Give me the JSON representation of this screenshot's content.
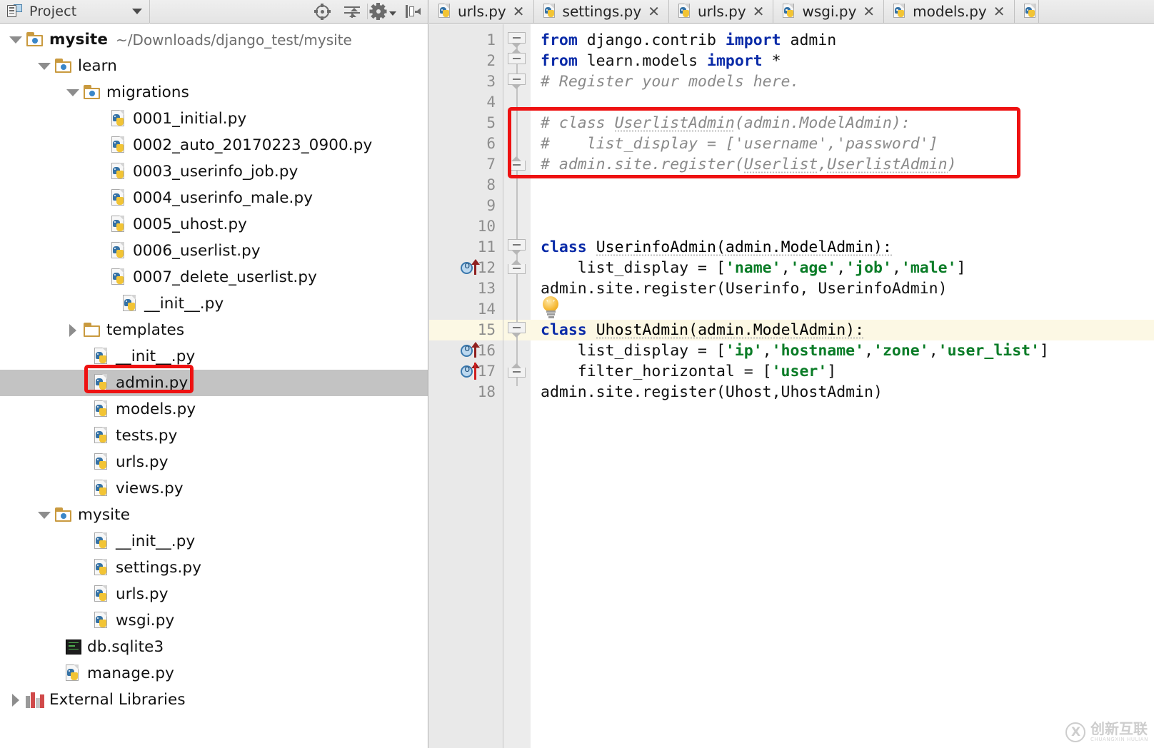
{
  "theme": {
    "accent_red": "#ee1111",
    "selection_gray": "#c3c3c3",
    "current_line_yellow": "#fcf8e4",
    "keyword_blue": "#0a2ba8",
    "string_green": "#0a7c27",
    "comment_gray": "#8a8a8a",
    "gutter_bg": "#e9e9e9",
    "toolbar_bg": "#e7e7e7"
  },
  "project_panel": {
    "title": "Project",
    "title_icon": "project-view-icon",
    "dropdown_icon": "chevron-down-icon",
    "toolbar_buttons": [
      {
        "name": "locate-in-tree-button",
        "icon": "crosshair-target-icon"
      },
      {
        "name": "collapse-all-button",
        "icon": "collapse-all-icon"
      },
      {
        "name": "settings-button",
        "icon": "gear-icon"
      },
      {
        "name": "hide-panel-button",
        "icon": "hide-sidebar-icon"
      }
    ]
  },
  "tree": [
    {
      "label": "mysite",
      "secondary": "~/Downloads/django_test/mysite",
      "icon": "folder-module-icon",
      "indent": 0,
      "twisty": "expanded",
      "bold": true,
      "selected": false
    },
    {
      "label": "learn",
      "secondary": "",
      "icon": "folder-module-icon",
      "indent": 1,
      "twisty": "expanded",
      "bold": false,
      "selected": false
    },
    {
      "label": "migrations",
      "secondary": "",
      "icon": "folder-module-icon",
      "indent": 2,
      "twisty": "expanded",
      "bold": false,
      "selected": false
    },
    {
      "label": "0001_initial.py",
      "secondary": "",
      "icon": "python-file-icon",
      "indent": 3,
      "twisty": "none",
      "bold": false,
      "selected": false
    },
    {
      "label": "0002_auto_20170223_0900.py",
      "secondary": "",
      "icon": "python-file-icon",
      "indent": 3,
      "twisty": "none",
      "bold": false,
      "selected": false
    },
    {
      "label": "0003_userinfo_job.py",
      "secondary": "",
      "icon": "python-file-icon",
      "indent": 3,
      "twisty": "none",
      "bold": false,
      "selected": false
    },
    {
      "label": "0004_userinfo_male.py",
      "secondary": "",
      "icon": "python-file-icon",
      "indent": 3,
      "twisty": "none",
      "bold": false,
      "selected": false
    },
    {
      "label": "0005_uhost.py",
      "secondary": "",
      "icon": "python-file-icon",
      "indent": 3,
      "twisty": "none",
      "bold": false,
      "selected": false
    },
    {
      "label": "0006_userlist.py",
      "secondary": "",
      "icon": "python-file-icon",
      "indent": 3,
      "twisty": "none",
      "bold": false,
      "selected": false
    },
    {
      "label": "0007_delete_userlist.py",
      "secondary": "",
      "icon": "python-file-icon",
      "indent": 3,
      "twisty": "none",
      "bold": false,
      "selected": false
    },
    {
      "label": "__init__.py",
      "secondary": "",
      "icon": "python-file-icon",
      "indent": 3.4,
      "twisty": "none",
      "bold": false,
      "selected": false
    },
    {
      "label": "templates",
      "secondary": "",
      "icon": "folder-plain-icon",
      "indent": 2,
      "twisty": "collapsed",
      "bold": false,
      "selected": false
    },
    {
      "label": "__init__.py",
      "secondary": "",
      "icon": "python-file-icon",
      "indent": 2.4,
      "twisty": "none",
      "bold": false,
      "selected": false
    },
    {
      "label": "admin.py",
      "secondary": "",
      "icon": "python-file-icon",
      "indent": 2.4,
      "twisty": "none",
      "bold": false,
      "selected": true
    },
    {
      "label": "models.py",
      "secondary": "",
      "icon": "python-file-icon",
      "indent": 2.4,
      "twisty": "none",
      "bold": false,
      "selected": false
    },
    {
      "label": "tests.py",
      "secondary": "",
      "icon": "python-file-icon",
      "indent": 2.4,
      "twisty": "none",
      "bold": false,
      "selected": false
    },
    {
      "label": "urls.py",
      "secondary": "",
      "icon": "python-file-icon",
      "indent": 2.4,
      "twisty": "none",
      "bold": false,
      "selected": false
    },
    {
      "label": "views.py",
      "secondary": "",
      "icon": "python-file-icon",
      "indent": 2.4,
      "twisty": "none",
      "bold": false,
      "selected": false
    },
    {
      "label": "mysite",
      "secondary": "",
      "icon": "folder-module-icon",
      "indent": 1,
      "twisty": "expanded",
      "bold": false,
      "selected": false
    },
    {
      "label": "__init__.py",
      "secondary": "",
      "icon": "python-file-icon",
      "indent": 2.4,
      "twisty": "none",
      "bold": false,
      "selected": false
    },
    {
      "label": "settings.py",
      "secondary": "",
      "icon": "python-file-icon",
      "indent": 2.4,
      "twisty": "none",
      "bold": false,
      "selected": false
    },
    {
      "label": "urls.py",
      "secondary": "",
      "icon": "python-file-icon",
      "indent": 2.4,
      "twisty": "none",
      "bold": false,
      "selected": false
    },
    {
      "label": "wsgi.py",
      "secondary": "",
      "icon": "python-file-icon",
      "indent": 2.4,
      "twisty": "none",
      "bold": false,
      "selected": false
    },
    {
      "label": "db.sqlite3",
      "secondary": "",
      "icon": "database-file-icon",
      "indent": 1.4,
      "twisty": "none",
      "bold": false,
      "selected": false
    },
    {
      "label": "manage.py",
      "secondary": "",
      "icon": "python-file-icon",
      "indent": 1.4,
      "twisty": "none",
      "bold": false,
      "selected": false
    },
    {
      "label": "External Libraries",
      "secondary": "",
      "icon": "library-icon",
      "indent": 0,
      "twisty": "collapsed",
      "bold": false,
      "selected": false
    }
  ],
  "editor": {
    "tabs": [
      {
        "label": "urls.py",
        "icon": "python-file-icon",
        "close_glyph": "✕",
        "active": false
      },
      {
        "label": "settings.py",
        "icon": "python-file-icon",
        "close_glyph": "✕",
        "active": false
      },
      {
        "label": "urls.py",
        "icon": "python-file-icon",
        "close_glyph": "✕",
        "active": false
      },
      {
        "label": "wsgi.py",
        "icon": "python-file-icon",
        "close_glyph": "✕",
        "active": false
      },
      {
        "label": "models.py",
        "icon": "python-file-icon",
        "close_glyph": "✕",
        "active": false
      }
    ],
    "partial_tab": {
      "label": "",
      "icon": "python-file-icon"
    },
    "current_line": 15,
    "line_numbers": [
      "1",
      "2",
      "3",
      "4",
      "5",
      "6",
      "7",
      "8",
      "9",
      "10",
      "11",
      "12",
      "13",
      "14",
      "15",
      "16",
      "17",
      "18"
    ],
    "lines": [
      {
        "n": 1,
        "tokens": [
          {
            "t": "from",
            "c": "kw"
          },
          {
            "t": " django.contrib ",
            "c": "plain"
          },
          {
            "t": "import",
            "c": "kw"
          },
          {
            "t": " admin",
            "c": "plain"
          }
        ]
      },
      {
        "n": 2,
        "tokens": [
          {
            "t": "from",
            "c": "kw"
          },
          {
            "t": " learn.models ",
            "c": "plain"
          },
          {
            "t": "import",
            "c": "kw"
          },
          {
            "t": " *",
            "c": "plain"
          }
        ]
      },
      {
        "n": 3,
        "tokens": [
          {
            "t": "# Register your models here.",
            "c": "cmt"
          }
        ]
      },
      {
        "n": 4,
        "tokens": []
      },
      {
        "n": 5,
        "tokens": [
          {
            "t": "# class ",
            "c": "cmt"
          },
          {
            "t": "UserlistAdmin",
            "c": "cmt sq"
          },
          {
            "t": "(admin.ModelAdmin):",
            "c": "cmt"
          }
        ]
      },
      {
        "n": 6,
        "tokens": [
          {
            "t": "#    list_display = ['username','password']",
            "c": "cmt"
          }
        ]
      },
      {
        "n": 7,
        "tokens": [
          {
            "t": "# admin.site.register(",
            "c": "cmt"
          },
          {
            "t": "Userlist",
            "c": "cmt sq"
          },
          {
            "t": ",",
            "c": "cmt"
          },
          {
            "t": "UserlistAdmin",
            "c": "cmt sq"
          },
          {
            "t": ")",
            "c": "cmt"
          }
        ]
      },
      {
        "n": 8,
        "tokens": []
      },
      {
        "n": 9,
        "tokens": []
      },
      {
        "n": 10,
        "tokens": []
      },
      {
        "n": 11,
        "tokens": [
          {
            "t": "class",
            "c": "kw"
          },
          {
            "t": " ",
            "c": "plain"
          },
          {
            "t": "UserinfoAdmin(admin.ModelAdmin):",
            "c": "cls sq"
          }
        ]
      },
      {
        "n": 12,
        "tokens": [
          {
            "t": "    list_display = [",
            "c": "plain"
          },
          {
            "t": "'name'",
            "c": "str"
          },
          {
            "t": ",",
            "c": "plain"
          },
          {
            "t": "'age'",
            "c": "str"
          },
          {
            "t": ",",
            "c": "plain"
          },
          {
            "t": "'job'",
            "c": "str"
          },
          {
            "t": ",",
            "c": "plain"
          },
          {
            "t": "'male'",
            "c": "str"
          },
          {
            "t": "]",
            "c": "plain"
          }
        ]
      },
      {
        "n": 13,
        "tokens": [
          {
            "t": "admin.site.register(Userinfo, UserinfoAdmin)",
            "c": "plain"
          }
        ]
      },
      {
        "n": 14,
        "tokens": []
      },
      {
        "n": 15,
        "tokens": [
          {
            "t": "class",
            "c": "kw"
          },
          {
            "t": " ",
            "c": "plain"
          },
          {
            "t": "UhostAdmin(admin.ModelAdmin):",
            "c": "cls sq"
          }
        ]
      },
      {
        "n": 16,
        "tokens": [
          {
            "t": "    list_display = [",
            "c": "plain"
          },
          {
            "t": "'ip'",
            "c": "str"
          },
          {
            "t": ",",
            "c": "plain"
          },
          {
            "t": "'hostname'",
            "c": "str"
          },
          {
            "t": ",",
            "c": "plain"
          },
          {
            "t": "'zone'",
            "c": "str"
          },
          {
            "t": ",",
            "c": "plain"
          },
          {
            "t": "'user_list'",
            "c": "str"
          },
          {
            "t": "]",
            "c": "plain"
          }
        ]
      },
      {
        "n": 17,
        "tokens": [
          {
            "t": "    filter_horizontal = [",
            "c": "plain"
          },
          {
            "t": "'user'",
            "c": "str"
          },
          {
            "t": "]",
            "c": "plain"
          }
        ]
      },
      {
        "n": 18,
        "tokens": [
          {
            "t": "admin.site.register(Uhost,UhostAdmin)",
            "c": "plain"
          }
        ]
      }
    ],
    "gutter_markers": [
      {
        "line": 12,
        "icon": "override-method-icon"
      },
      {
        "line": 16,
        "icon": "override-method-icon"
      },
      {
        "line": 17,
        "icon": "override-method-icon"
      }
    ],
    "fold_markers": [
      {
        "line": 1,
        "kind": "start"
      },
      {
        "line": 2,
        "kind": "mid"
      },
      {
        "line": 3,
        "kind": "start"
      },
      {
        "line": 7,
        "kind": "end"
      },
      {
        "line": 11,
        "kind": "start"
      },
      {
        "line": 12,
        "kind": "end"
      },
      {
        "line": 15,
        "kind": "start"
      },
      {
        "line": 17,
        "kind": "end"
      }
    ],
    "intention_bulb": {
      "line": 14,
      "icon": "lightbulb-intention-icon"
    }
  },
  "annotations": [
    {
      "name": "code-highlight-box",
      "target": "commented-userlist-admin-block",
      "color": "#ee1111"
    },
    {
      "name": "tree-highlight-box",
      "target": "admin-py-file",
      "color": "#ee1111"
    }
  ],
  "watermark": {
    "logo_icon": "circle-x-logo-icon",
    "cn_text": "创新互联",
    "en_text": "CHUANGXIN HULIAN"
  }
}
